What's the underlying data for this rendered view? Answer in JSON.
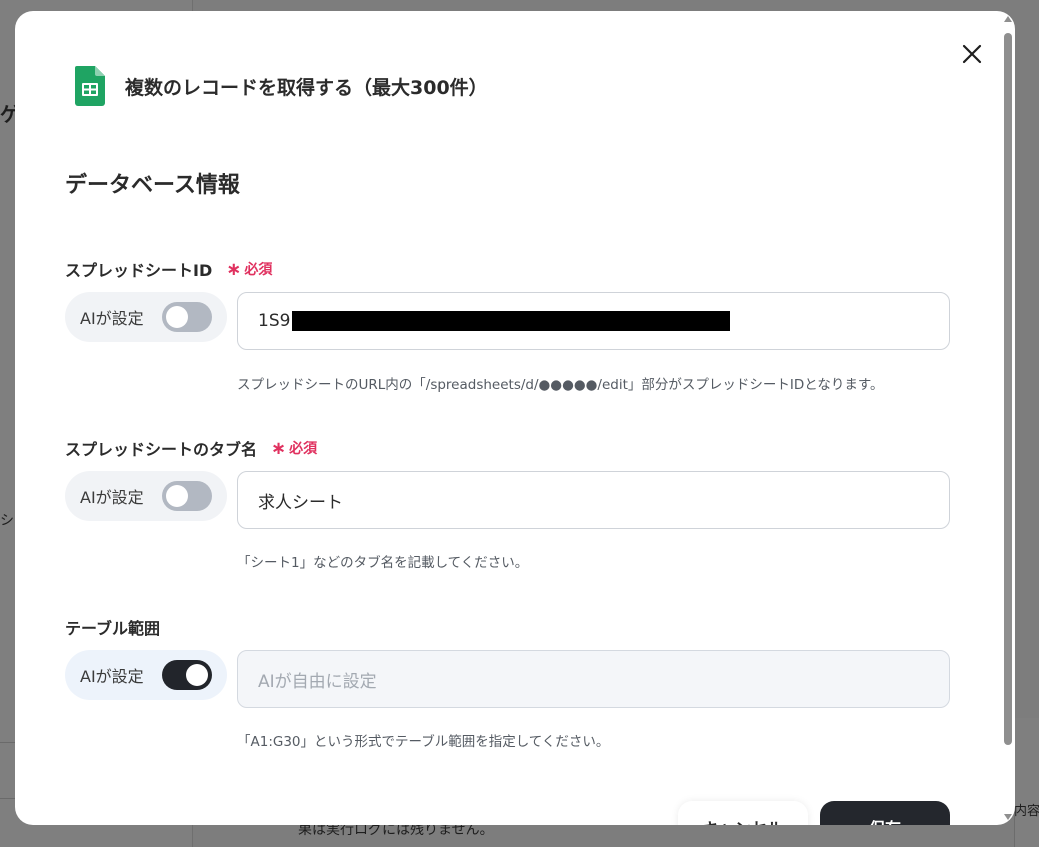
{
  "background": {
    "fragment_left_top": "ゲ",
    "fragment_left_mid": "シ",
    "fragment_bottom": "果は実行ログには残りません。",
    "fragment_right": "内容"
  },
  "modal": {
    "icon": "google-sheets-icon",
    "title": "複数のレコードを取得する（最大300件）",
    "close_icon": "close-icon",
    "section_title": "データベース情報",
    "fields": [
      {
        "label": "スプレッドシートID",
        "required_label": "必須",
        "ai_label": "AIが設定",
        "ai_enabled": false,
        "value": "1S9",
        "redacted": true,
        "placeholder": "",
        "hint": "スプレッドシートのURL内の「/spreadsheets/d/●●●●●/edit」部分がスプレッドシートIDとなります。"
      },
      {
        "label": "スプレッドシートのタブ名",
        "required_label": "必須",
        "ai_label": "AIが設定",
        "ai_enabled": false,
        "value": "求人シート",
        "placeholder": "",
        "hint": "「シート1」などのタブ名を記載してください。"
      },
      {
        "label": "テーブル範囲",
        "ai_label": "AIが設定",
        "ai_enabled": true,
        "value": "",
        "placeholder": "AIが自由に設定",
        "hint": "「A1:G30」という形式でテーブル範囲を指定してください。"
      }
    ],
    "buttons": {
      "cancel_label": "キャンセル",
      "save_label": "保存"
    }
  },
  "colors": {
    "required": "#e0315f",
    "toggle_on": "#22252b",
    "toggle_off": "#b2b8c2",
    "sheets_green": "#1fa463"
  }
}
